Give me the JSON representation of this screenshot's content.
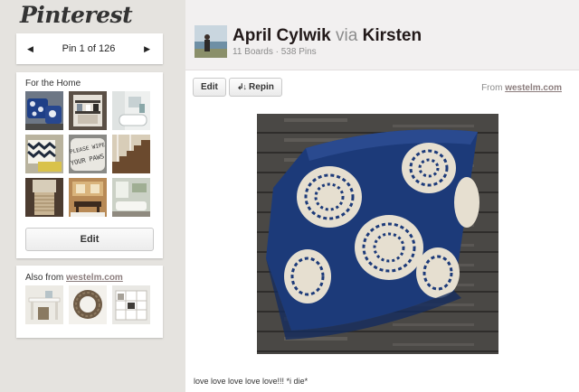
{
  "app": {
    "logo": "Pinterest"
  },
  "pin_nav": {
    "prev_icon": "left-triangle-icon",
    "label": "Pin 1 of 126",
    "next_icon": "right-triangle-icon"
  },
  "board": {
    "title": "For the Home",
    "edit_label": "Edit",
    "thumbnails": [
      "blue-pillows",
      "bathroom-shelf",
      "white-bath",
      "chevron-pillows",
      "please-wipe-your-paws-pillow",
      "wooden-stairs",
      "rope-lamp",
      "dining-room",
      "white-living-room"
    ]
  },
  "also_from": {
    "prefix": "Also from",
    "site": "westelm.com",
    "thumbnails": [
      "white-desk",
      "woven-wreath",
      "white-bookshelf"
    ]
  },
  "pinner": {
    "name": "April Cylwik",
    "via": "via",
    "via_name": "Kirsten",
    "stats": "11 Boards · 538 Pins"
  },
  "actions": {
    "edit_label": "Edit",
    "repin_label": "Repin",
    "repin_icon": "repin-icon"
  },
  "source": {
    "prefix": "From",
    "site": "westelm.com"
  },
  "pin": {
    "image": "blue-pillow-with-white-medallions-on-wood",
    "description": "love love love love love!!! *i die*"
  }
}
